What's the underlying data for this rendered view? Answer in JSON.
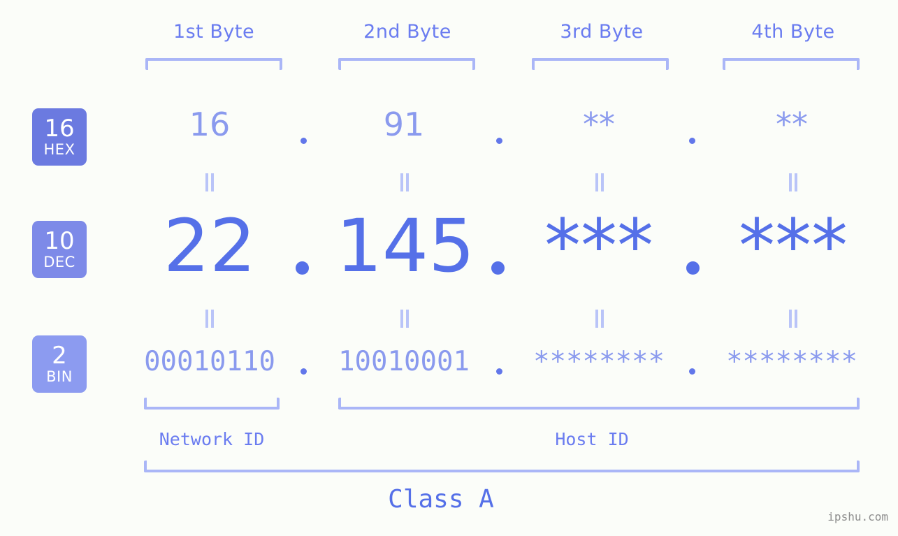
{
  "page": {
    "background_color": "#fbfdf9",
    "watermark": "ipshu.com"
  },
  "colors": {
    "hex_badge": "#6b7ae0",
    "dec_badge": "#7d8ae8",
    "bin_badge": "#8c9bf0",
    "hex_text": "#8a9aee",
    "dec_text": "#5570e8",
    "bin_text": "#8a9aee",
    "bracket": "#aab6f7",
    "header_text": "#6a7cf0",
    "connector": "#b9c4f8"
  },
  "byte_headers": [
    {
      "label": "1st Byte"
    },
    {
      "label": "2nd Byte"
    },
    {
      "label": "3rd Byte"
    },
    {
      "label": "4th Byte"
    }
  ],
  "radix_badges": [
    {
      "number": "16",
      "unit": "HEX"
    },
    {
      "number": "10",
      "unit": "DEC"
    },
    {
      "number": "2",
      "unit": "BIN"
    }
  ],
  "rows": {
    "hex": {
      "radix": "16",
      "name": "HEX",
      "values": [
        "16",
        "91",
        "**",
        "**"
      ]
    },
    "dec": {
      "radix": "10",
      "name": "DEC",
      "values": [
        "22",
        "145",
        "***",
        "***"
      ]
    },
    "bin": {
      "radix": "2",
      "name": "BIN",
      "values": [
        "00010110",
        "10010001",
        "********",
        "********"
      ]
    }
  },
  "separator": ".",
  "sections": {
    "network_id": "Network ID",
    "host_id": "Host ID",
    "class": "Class A"
  }
}
